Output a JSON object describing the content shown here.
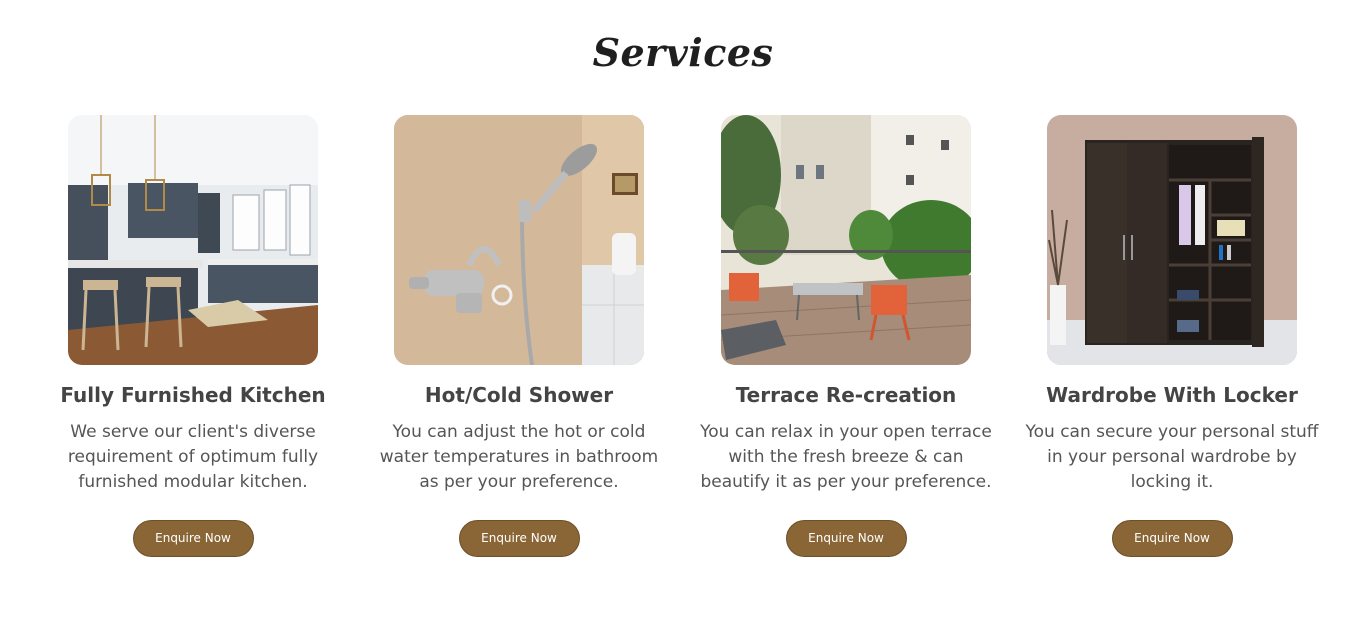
{
  "section": {
    "title": "Services"
  },
  "colors": {
    "button_bg": "#8a6535",
    "title_text": "#1f1f1f",
    "body_text": "#555555"
  },
  "services": [
    {
      "image": "kitchen-photo",
      "title": "Fully Furnished Kitchen",
      "description": "We serve our client's diverse requirement of optimum fully furnished modular kitchen.",
      "button_label": "Enquire Now"
    },
    {
      "image": "shower-photo",
      "title": "Hot/Cold Shower",
      "description": "You can adjust the hot or cold water temperatures in bathroom as per your preference.",
      "button_label": "Enquire Now"
    },
    {
      "image": "terrace-photo",
      "title": "Terrace Re-creation",
      "description": "You can relax in your open terrace with the fresh breeze & can beautify it as per your preference.",
      "button_label": "Enquire Now"
    },
    {
      "image": "wardrobe-photo",
      "title": "Wardrobe With Locker",
      "description": "You can secure your personal stuff in your personal wardrobe by locking it.",
      "button_label": "Enquire Now"
    }
  ]
}
